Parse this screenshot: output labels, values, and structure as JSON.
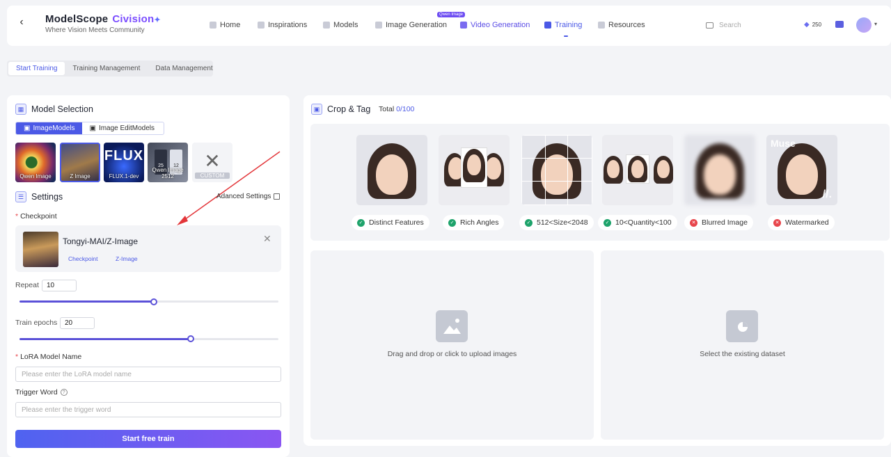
{
  "header": {
    "brand_name": "ModelScope",
    "brand_sub": "Civision",
    "tagline": "Where Vision Meets Community",
    "nav": [
      {
        "label": "Home",
        "icon": "home-icon"
      },
      {
        "label": "Inspirations",
        "icon": "bulb-icon"
      },
      {
        "label": "Models",
        "icon": "cube-icon"
      },
      {
        "label": "Image Generation",
        "icon": "image-gen-icon"
      },
      {
        "label": "Video Generation",
        "icon": "video-gen-icon"
      },
      {
        "label": "Training",
        "icon": "training-icon"
      },
      {
        "label": "Resources",
        "icon": "resources-icon"
      }
    ],
    "active_nav": "Training",
    "nav_badge": "Qwen Image",
    "search_placeholder": "Search",
    "credits": "250"
  },
  "tabs": [
    {
      "label": "Start Training",
      "active": true
    },
    {
      "label": "Training Management",
      "active": false
    },
    {
      "label": "Data Management",
      "active": false
    }
  ],
  "model_selection": {
    "title": "Model Selection",
    "toggle": [
      {
        "label": "ImageModels",
        "active": true
      },
      {
        "label": "Image EditModels",
        "active": false
      }
    ],
    "models": [
      {
        "label": "Qwen Image"
      },
      {
        "label": "Z Image",
        "selected": true
      },
      {
        "label": "FLUX.1-dev",
        "art_text": "FLUX"
      },
      {
        "label": "Qwen Image 2512",
        "art_text_1": "25",
        "art_text_2": "12"
      },
      {
        "label": "CUSTOM"
      }
    ]
  },
  "settings": {
    "title": "Settings",
    "advanced_label": "Adanced Settings",
    "checkpoint_label": "Checkpoint",
    "checkpoint_name": "Tongyi-MAI/Z-Image",
    "checkpoint_tags": [
      "Checkpoint",
      "Z-Image"
    ],
    "repeat_label": "Repeat",
    "repeat_value": "10",
    "repeat_fraction": 0.52,
    "epochs_label": "Train epochs",
    "epochs_value": "20",
    "epochs_fraction": 0.66,
    "lora_label": "LoRA Model Name",
    "lora_placeholder": "Please enter the LoRA model name",
    "trigger_label": "Trigger Word",
    "trigger_placeholder": "Please enter the trigger word",
    "start_button": "Start free train"
  },
  "crop_tag": {
    "title": "Crop & Tag",
    "total_label": "Total",
    "total_value": "0/100",
    "examples": [
      {
        "label": "Distinct Features",
        "ok": true
      },
      {
        "label": "Rich Angles",
        "ok": true
      },
      {
        "label": "512<Size<2048",
        "ok": true
      },
      {
        "label": "10<Quantity<100",
        "ok": true
      },
      {
        "label": "Blurred Image",
        "ok": false
      },
      {
        "label": "Watermarked",
        "ok": false,
        "overlay": "Muse"
      }
    ],
    "upload_text": "Drag and drop or click to upload images",
    "existing_text": "Select the existing dataset"
  },
  "colors": {
    "accent": "#4b59e6",
    "ok": "#1ea36b",
    "bad": "#e8454b"
  }
}
